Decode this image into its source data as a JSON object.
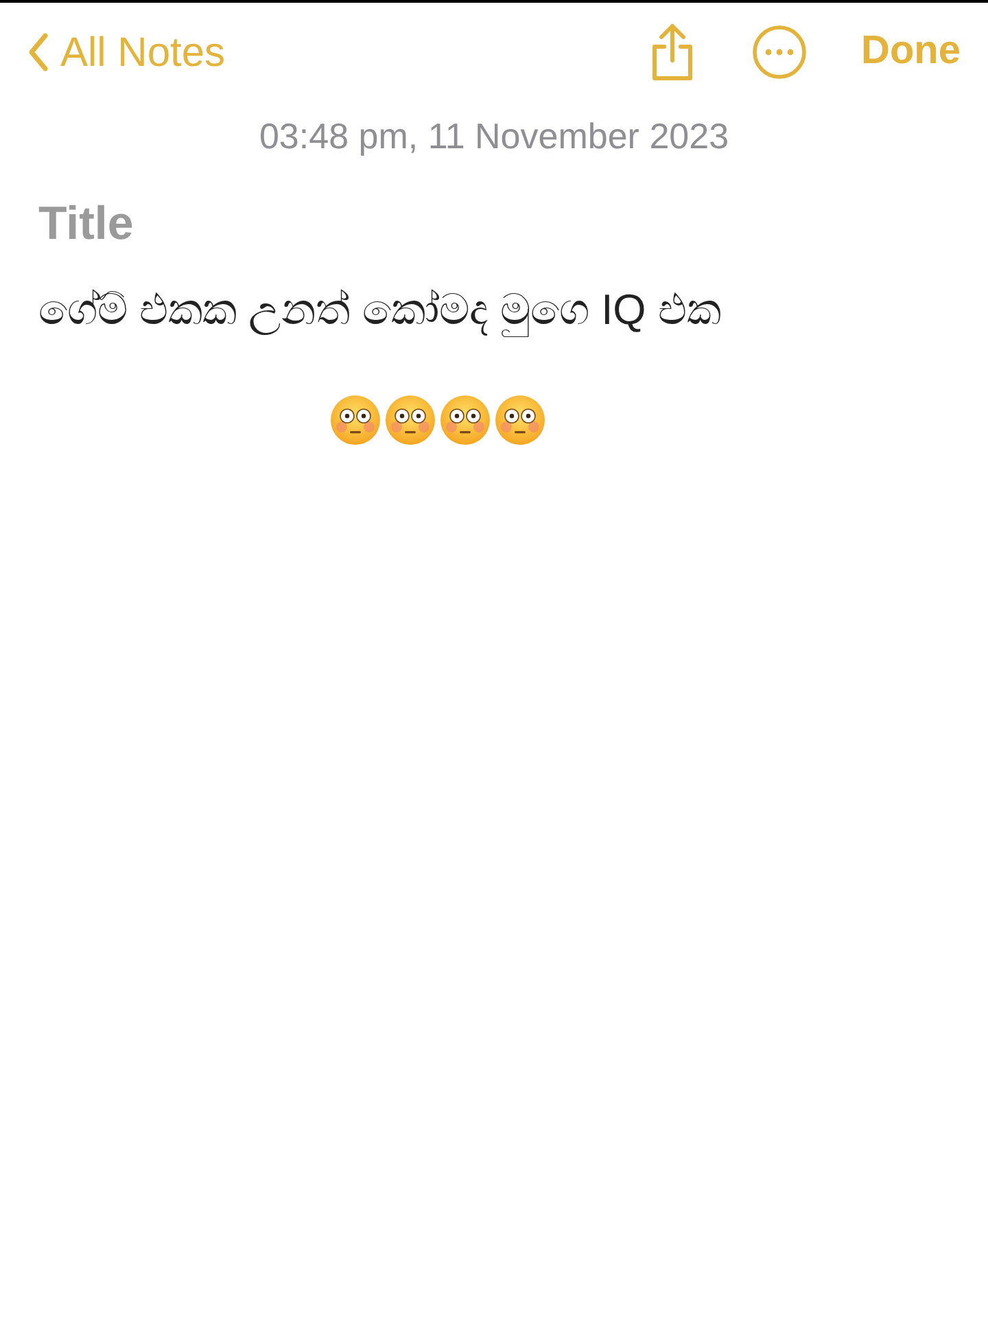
{
  "nav": {
    "back": "All Notes",
    "done": "Done"
  },
  "date": "03:48 pm, 11 November 2023",
  "note": {
    "title_placeholder": "Title",
    "body": "ගේම් එකක උනත් කෝමද මුගෙ IQ එක",
    "emojis": [
      {
        "kind": "flushed"
      },
      {
        "kind": "flushed"
      },
      {
        "kind": "flushed"
      },
      {
        "kind": "flushed"
      }
    ]
  }
}
